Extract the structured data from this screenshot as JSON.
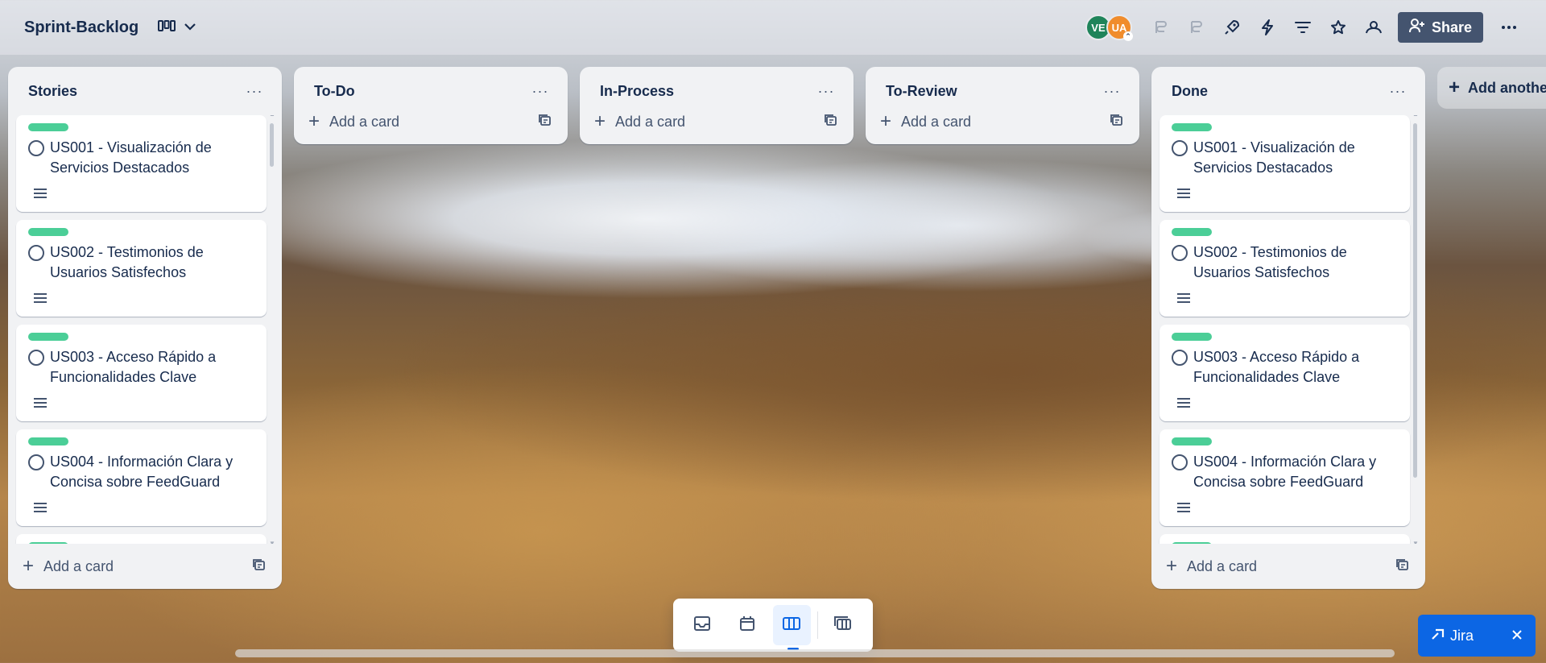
{
  "board": {
    "title": "Sprint-Backlog",
    "share_label": "Share",
    "avatars": [
      {
        "initials": "VE",
        "color": "#1f845a"
      },
      {
        "initials": "UA",
        "color": "#f08c2c"
      }
    ]
  },
  "lists": [
    {
      "title": "Stories",
      "add_card_label": "Add a card",
      "cards": [
        {
          "title": "US001 - Visualización de Servicios Destacados",
          "label_color": "#4bce97"
        },
        {
          "title": "US002 - Testimonios de Usuarios Satisfechos",
          "label_color": "#4bce97"
        },
        {
          "title": "US003 - Acceso Rápido a Funcionalidades Clave",
          "label_color": "#4bce97"
        },
        {
          "title": "US004 - Información Clara y Concisa sobre FeedGuard",
          "label_color": "#4bce97"
        }
      ]
    },
    {
      "title": "To-Do",
      "add_card_label": "Add a card",
      "cards": []
    },
    {
      "title": "In-Process",
      "add_card_label": "Add a card",
      "cards": []
    },
    {
      "title": "To-Review",
      "add_card_label": "Add a card",
      "cards": []
    },
    {
      "title": "Done",
      "add_card_label": "Add a card",
      "cards": [
        {
          "title": "US001 - Visualización de Servicios Destacados",
          "label_color": "#4bce97"
        },
        {
          "title": "US002 - Testimonios de Usuarios Satisfechos",
          "label_color": "#4bce97"
        },
        {
          "title": "US003 - Acceso Rápido a Funcionalidades Clave",
          "label_color": "#4bce97"
        },
        {
          "title": "US004 - Información Clara y Concisa sobre FeedGuard",
          "label_color": "#4bce97"
        }
      ]
    }
  ],
  "add_another_list_label": "Add another list",
  "bottom_switcher": {
    "items": [
      "inbox-icon",
      "calendar-icon",
      "board-icon",
      "switch-boards-icon"
    ],
    "active": "board-icon"
  },
  "jira_button": {
    "label": "Jira"
  }
}
